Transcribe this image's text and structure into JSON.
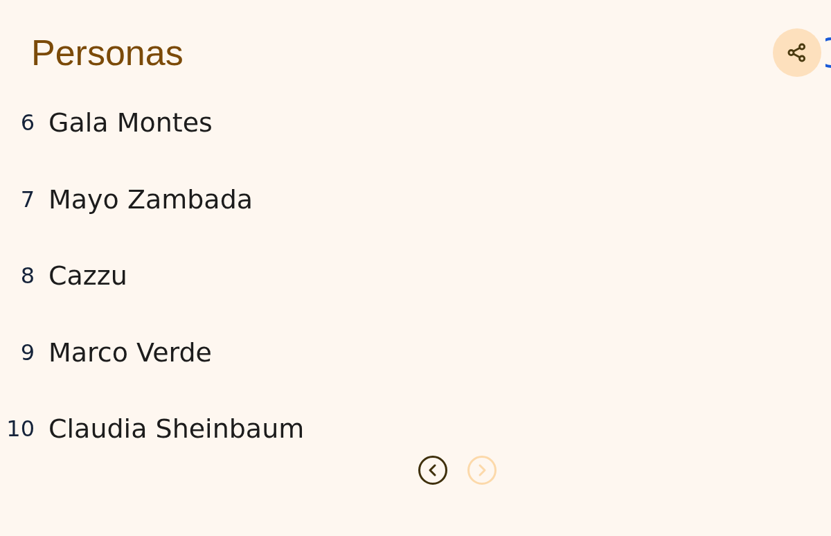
{
  "title": "Personas",
  "items": [
    {
      "rank": "6",
      "name": "Gala Montes"
    },
    {
      "rank": "7",
      "name": "Mayo Zambada"
    },
    {
      "rank": "8",
      "name": "Cazzu"
    },
    {
      "rank": "9",
      "name": "Marco Verde"
    },
    {
      "rank": "10",
      "name": "Claudia Sheinbaum"
    }
  ],
  "pager": [
    {
      "kind": "previous",
      "disabled": false
    },
    {
      "kind": "next",
      "disabled": true
    }
  ]
}
